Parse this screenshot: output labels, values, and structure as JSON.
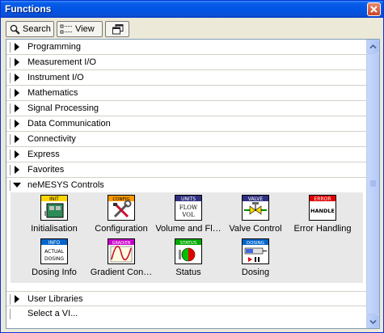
{
  "window": {
    "title": "Functions"
  },
  "toolbar": {
    "search_label": "Search",
    "view_label": "View"
  },
  "categories": [
    "Programming",
    "Measurement I/O",
    "Instrument I/O",
    "Mathematics",
    "Signal Processing",
    "Data Communication",
    "Connectivity",
    "Express",
    "Favorites",
    "neMESYS Controls"
  ],
  "palette": {
    "items": [
      {
        "label": "Initialisation",
        "banner": "INIT",
        "icon": "init-icon",
        "banner_color": "#ffd700"
      },
      {
        "label": "Configuration",
        "banner": "CONFIG",
        "icon": "tools-icon",
        "banner_color": "#ff9900"
      },
      {
        "label": "Volume and Fl…",
        "banner": "UNITS",
        "icon": "flow-vol-icon",
        "banner_color": "#303080"
      },
      {
        "label": "Valve Control",
        "banner": "VALVE",
        "icon": "valve-icon",
        "banner_color": "#303080"
      },
      {
        "label": "Error Handling",
        "banner": "ERROR",
        "icon": "error-handle-icon",
        "banner_color": "#e00000"
      },
      {
        "label": "Dosing Info",
        "banner": "INFO",
        "icon": "dosing-info-icon",
        "banner_color": "#0066cc"
      },
      {
        "label": "Gradient Con…",
        "banner": "GRADIEN",
        "icon": "gradient-icon",
        "banner_color": "#cc00cc"
      },
      {
        "label": "Status",
        "banner": "STATUS",
        "icon": "status-icon",
        "banner_color": "#00aa00"
      },
      {
        "label": "Dosing",
        "banner": "DOSING",
        "icon": "dosing-icon",
        "banner_color": "#0066cc"
      }
    ]
  },
  "bottom": {
    "user_libraries": "User Libraries",
    "select_vi": "Select a VI..."
  }
}
